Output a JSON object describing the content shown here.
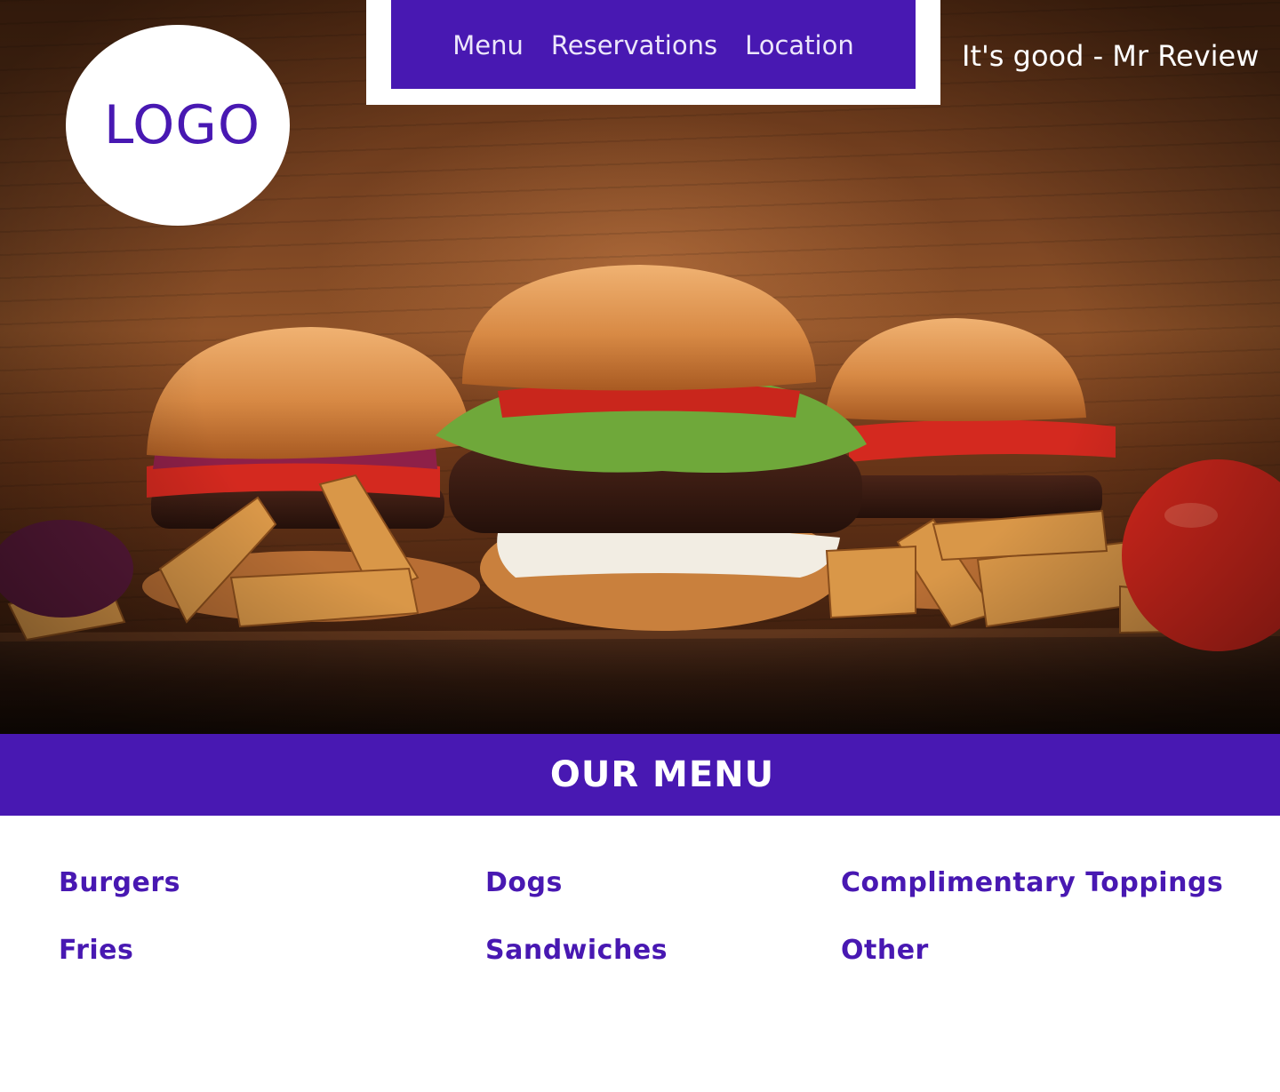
{
  "logo": {
    "text": "LOGO"
  },
  "nav": {
    "items": [
      {
        "label": "Menu"
      },
      {
        "label": "Reservations"
      },
      {
        "label": "Location"
      }
    ]
  },
  "review": {
    "text": "It's good - Mr Review"
  },
  "hero": {
    "image_description": "burgers-and-fries-photo"
  },
  "menu_section": {
    "title": "OUR MENU",
    "categories": [
      {
        "label": "Burgers"
      },
      {
        "label": "Dogs"
      },
      {
        "label": "Complimentary Toppings"
      },
      {
        "label": "Fries"
      },
      {
        "label": "Sandwiches"
      },
      {
        "label": "Other"
      }
    ]
  },
  "colors": {
    "brand": "#4818b2",
    "brand_text_light": "#ece6fb",
    "background": "#ffffff"
  }
}
